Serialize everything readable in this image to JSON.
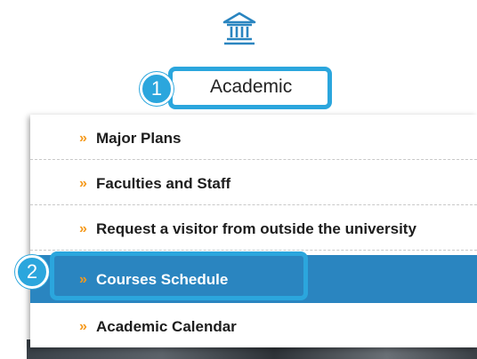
{
  "header": {
    "icon": "institution-building-icon",
    "academic_label": "Academic"
  },
  "callouts": [
    "1",
    "2"
  ],
  "menu": {
    "items": [
      {
        "label": "Major Plans",
        "active": false
      },
      {
        "label": "Faculties and Staff",
        "active": false
      },
      {
        "label": "Request a visitor from outside the university",
        "active": false
      },
      {
        "label": "Courses Schedule",
        "active": true
      },
      {
        "label": "Academic Calendar",
        "active": false
      }
    ],
    "chevron": "»"
  },
  "colors": {
    "callout_blue": "#2ba6dd",
    "active_blue": "#2a85c0",
    "chevron_orange": "#f59a1d"
  }
}
